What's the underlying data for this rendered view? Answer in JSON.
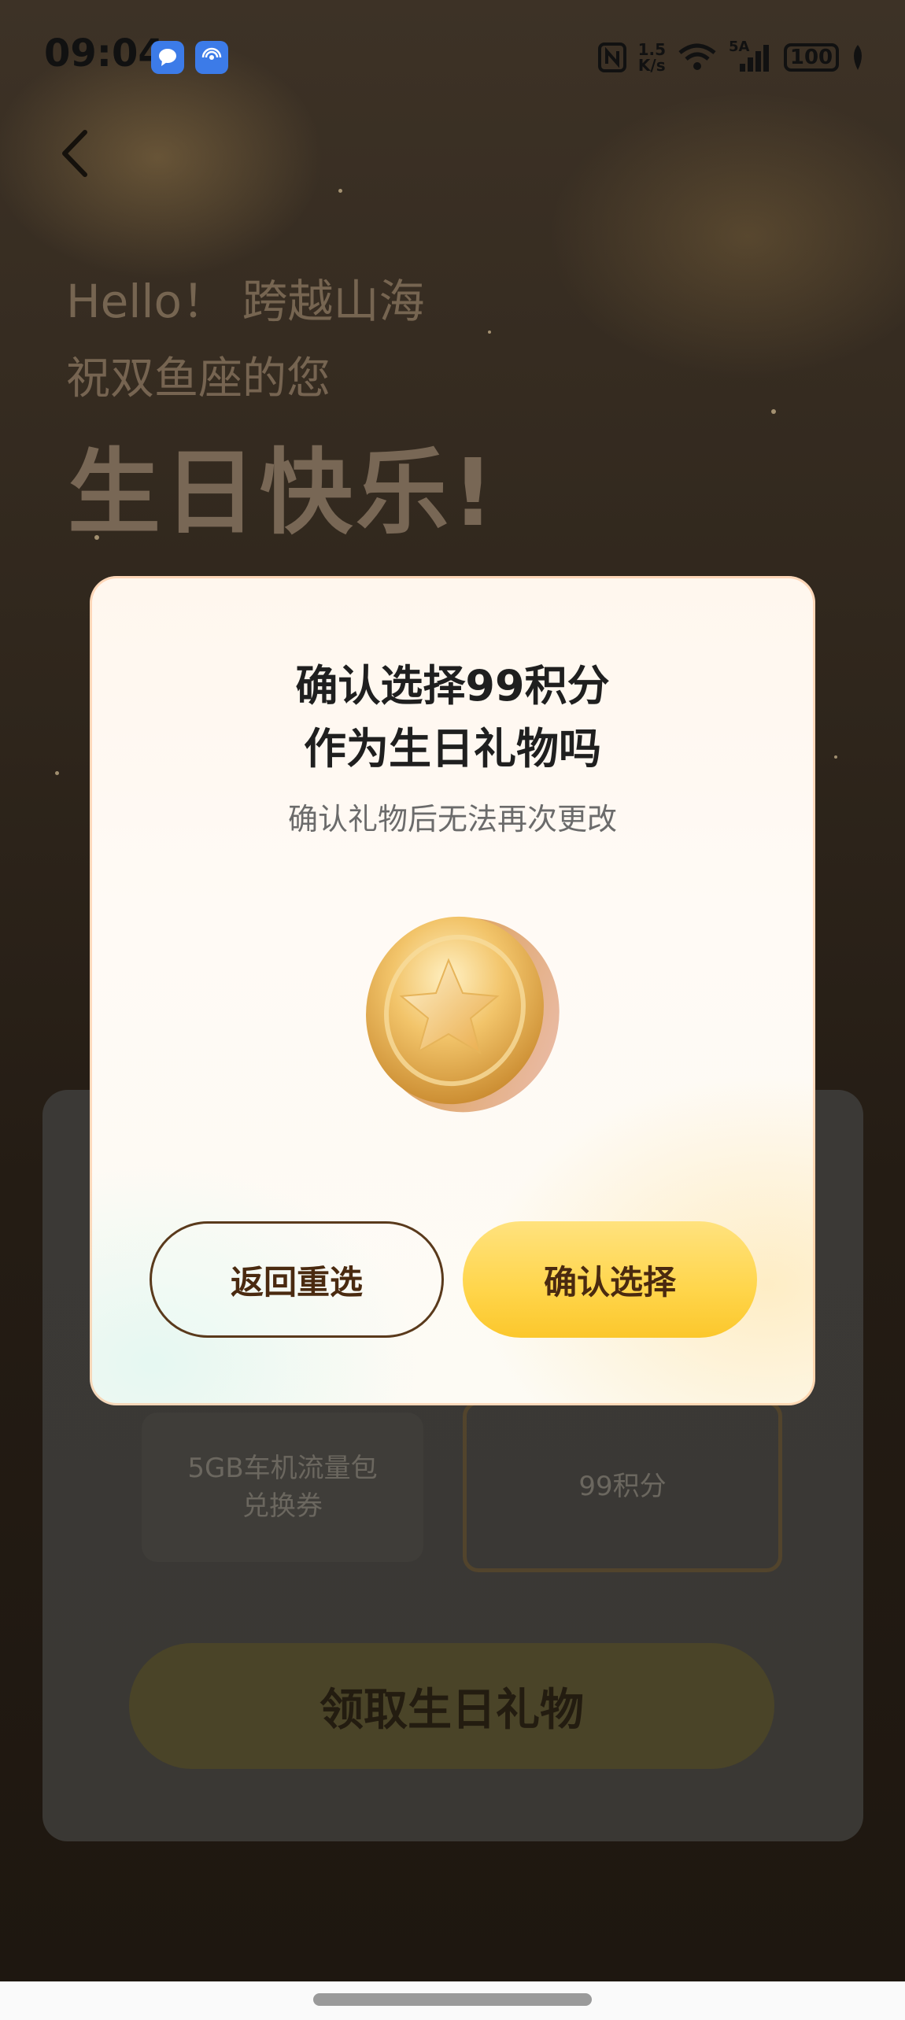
{
  "status_bar": {
    "time": "09:04",
    "net_speed_top": "1.5",
    "net_speed_bottom": "K/s",
    "signal_label": "5A",
    "battery": "100",
    "icons": [
      "message-icon",
      "hotspot-icon",
      "nfc-icon",
      "wifi-icon",
      "signal-icon",
      "battery-icon",
      "leaf-icon"
    ]
  },
  "background": {
    "greeting": "Hello！ 跨越山海",
    "wish": "祝双鱼座的您",
    "happy_birthday": "生日快乐!",
    "gift_options": [
      {
        "label": "5GB车机流量包\n兑换券"
      },
      {
        "label": "99积分"
      }
    ],
    "claim_button": "领取生日礼物"
  },
  "dialog": {
    "title_line1": "确认选择99积分",
    "title_line2": "作为生日礼物吗",
    "subtitle": "确认礼物后无法再次更改",
    "image_icon": "gold-star-coin-icon",
    "back_button": "返回重选",
    "confirm_button": "确认选择"
  },
  "colors": {
    "confirm_button": "#ffd54a",
    "button_text": "#4a2a10",
    "accent_outline": "#5a3a1c"
  }
}
